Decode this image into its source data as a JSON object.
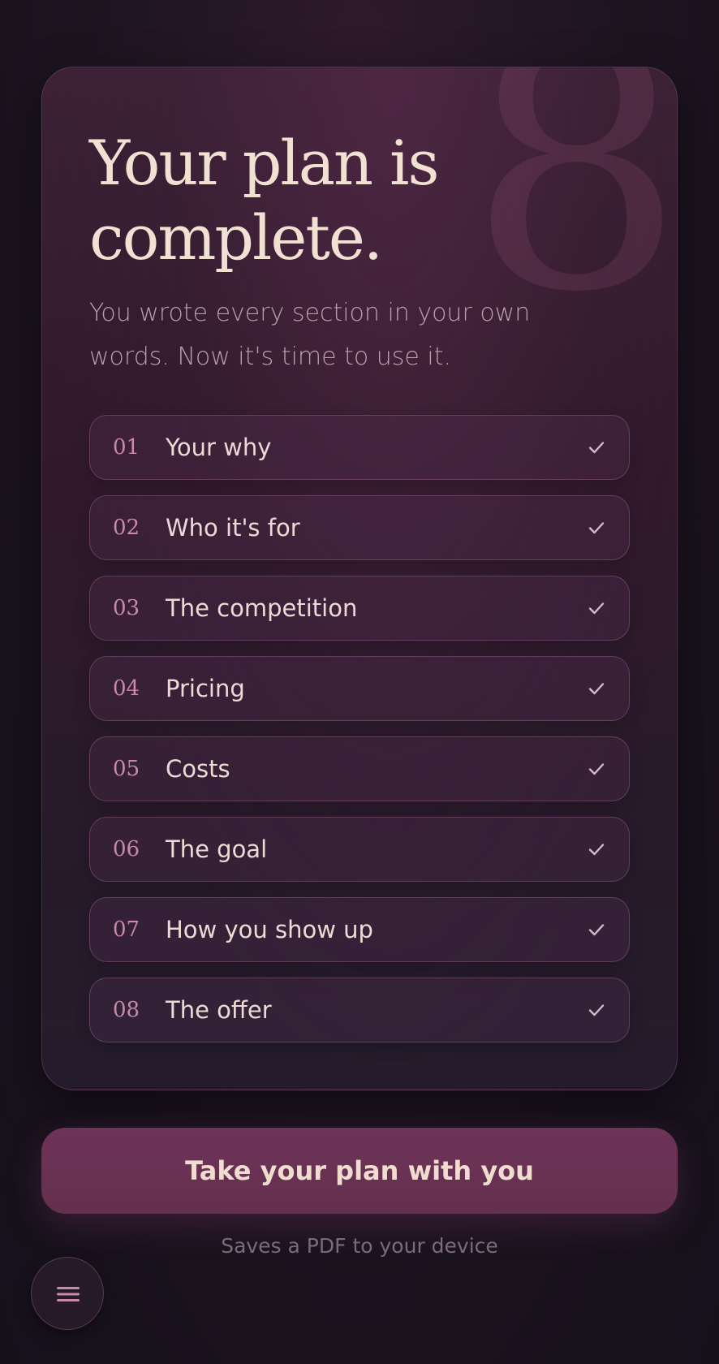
{
  "hero": {
    "title": "Your plan is complete.",
    "subtitle": "You wrote every section in your own words. Now it's time to use it.",
    "decorative_numeral": "8"
  },
  "steps": [
    {
      "number": "01",
      "label": "Your why",
      "status": "complete",
      "icon": "check-icon"
    },
    {
      "number": "02",
      "label": "Who it's for",
      "status": "complete",
      "icon": "check-icon"
    },
    {
      "number": "03",
      "label": "The competition",
      "status": "complete",
      "icon": "check-icon"
    },
    {
      "number": "04",
      "label": "Pricing",
      "status": "complete",
      "icon": "check-icon"
    },
    {
      "number": "05",
      "label": "Costs",
      "status": "complete",
      "icon": "check-icon"
    },
    {
      "number": "06",
      "label": "The goal",
      "status": "complete",
      "icon": "check-icon"
    },
    {
      "number": "07",
      "label": "How you show up",
      "status": "complete",
      "icon": "check-icon"
    },
    {
      "number": "08",
      "label": "The offer",
      "status": "complete",
      "icon": "check-icon"
    }
  ],
  "cta": {
    "label": "Take your plan with you",
    "hint": "Saves a PDF to your device"
  },
  "menu": {
    "icon": "hamburger-menu-icon"
  },
  "colors": {
    "background": "#1d1420",
    "card": "#30192b",
    "title": "#f1e1d2",
    "accent": "#c889ac",
    "cta": "#6e3358"
  }
}
